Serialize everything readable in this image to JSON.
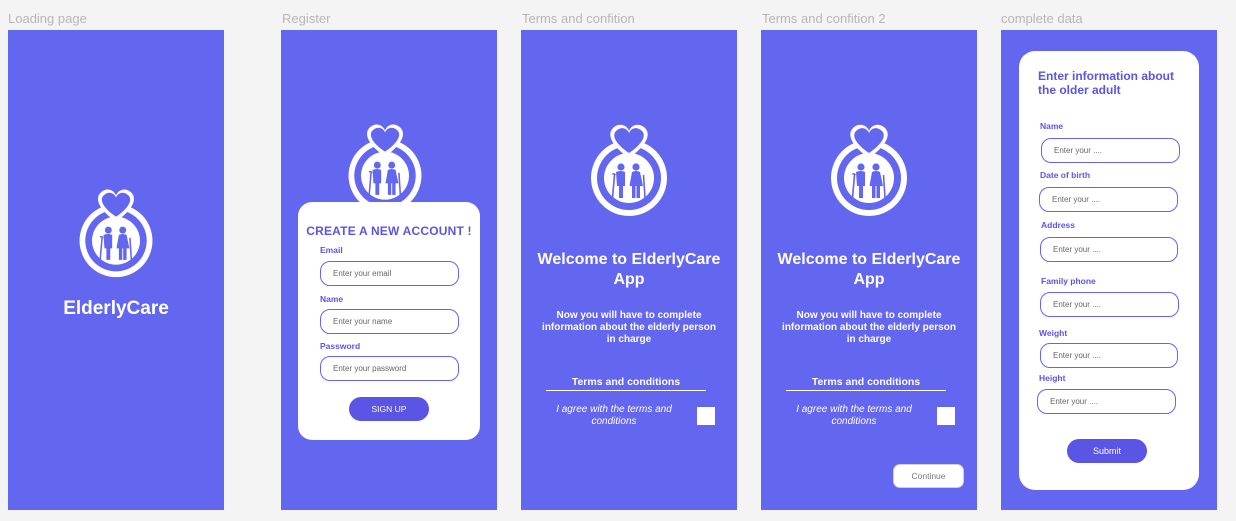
{
  "frames": {
    "loading": {
      "label": "Loading page",
      "app_name": "ElderlyCare"
    },
    "register": {
      "label": "Register",
      "title": "CREATE A NEW ACCOUNT !",
      "email_label": "Email",
      "email_placeholder": "Enter your email",
      "name_label": "Name",
      "name_placeholder": "Enter your name",
      "password_label": "Password",
      "password_placeholder": "Enter your password",
      "signup_label": "SIGN UP"
    },
    "terms": {
      "label": "Terms and confition",
      "welcome": "Welcome to ElderlyCare App",
      "subtext": "Now you will have to complete information about the elderly person in charge",
      "terms_title": "Terms and conditions",
      "agree_text": "I agree with the terms and conditions"
    },
    "terms2": {
      "label": "Terms and confition 2",
      "welcome": "Welcome to ElderlyCare App",
      "subtext": "Now you will have to complete information about the elderly person in charge",
      "terms_title": "Terms and conditions",
      "agree_text": "I agree with the terms and conditions",
      "continue_label": "Continue"
    },
    "complete": {
      "label": "complete data",
      "title": "Enter information about the older adult",
      "fields": [
        {
          "label": "Name",
          "placeholder": "Enter your ...."
        },
        {
          "label": "Date of birth",
          "placeholder": "Enter your ...."
        },
        {
          "label": "Address",
          "placeholder": "Enter your ...."
        },
        {
          "label": "Family phone",
          "placeholder": "Enter your ...."
        },
        {
          "label": "Weight",
          "placeholder": "Enter your ...."
        },
        {
          "label": "Height",
          "placeholder": "Enter your ...."
        }
      ],
      "submit_label": "Submit"
    }
  },
  "colors": {
    "brand_purple": "#6366ef",
    "accent_purple": "#5b55e6",
    "canvas_bg": "#f4f4f4"
  },
  "icons": {
    "logo": "elderly-couple-heart-ring-icon"
  }
}
